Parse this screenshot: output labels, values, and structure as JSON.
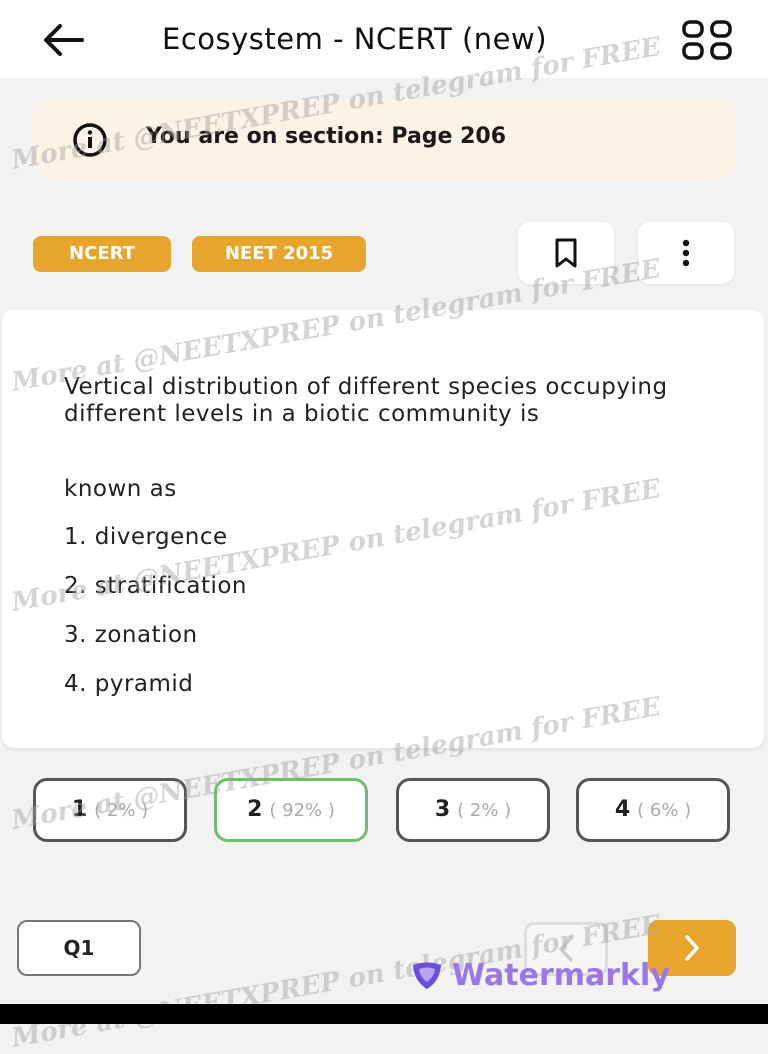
{
  "header": {
    "title": "Ecosystem - NCERT (new)",
    "back_icon": "arrow-left-icon",
    "grid_icon": "grid-icon"
  },
  "section_banner": {
    "text": "You are on section: Page 206",
    "icon": "info-icon"
  },
  "tags": [
    "NCERT",
    "NEET 2015"
  ],
  "question": {
    "text": "Vertical distribution of different species occupying different levels in a biotic community is",
    "continuation": "known as",
    "options": [
      "1. divergence",
      "2. stratification",
      "3. zonation",
      "4. pyramid"
    ]
  },
  "answers": [
    {
      "num": "1",
      "pct": "( 2% )"
    },
    {
      "num": "2",
      "pct": "( 92% )"
    },
    {
      "num": "3",
      "pct": "( 2% )"
    },
    {
      "num": "4",
      "pct": "( 6% )"
    }
  ],
  "footer": {
    "question_label": "Q1",
    "watermark_brand": "Watermarkly"
  },
  "watermark_text": "More at @NEETXPREP on telegram for FREE",
  "colors": {
    "accent": "#e8a52e",
    "correct": "#6dc06a",
    "banner_bg": "#fbf3e6",
    "brand": "#9b76e8"
  }
}
